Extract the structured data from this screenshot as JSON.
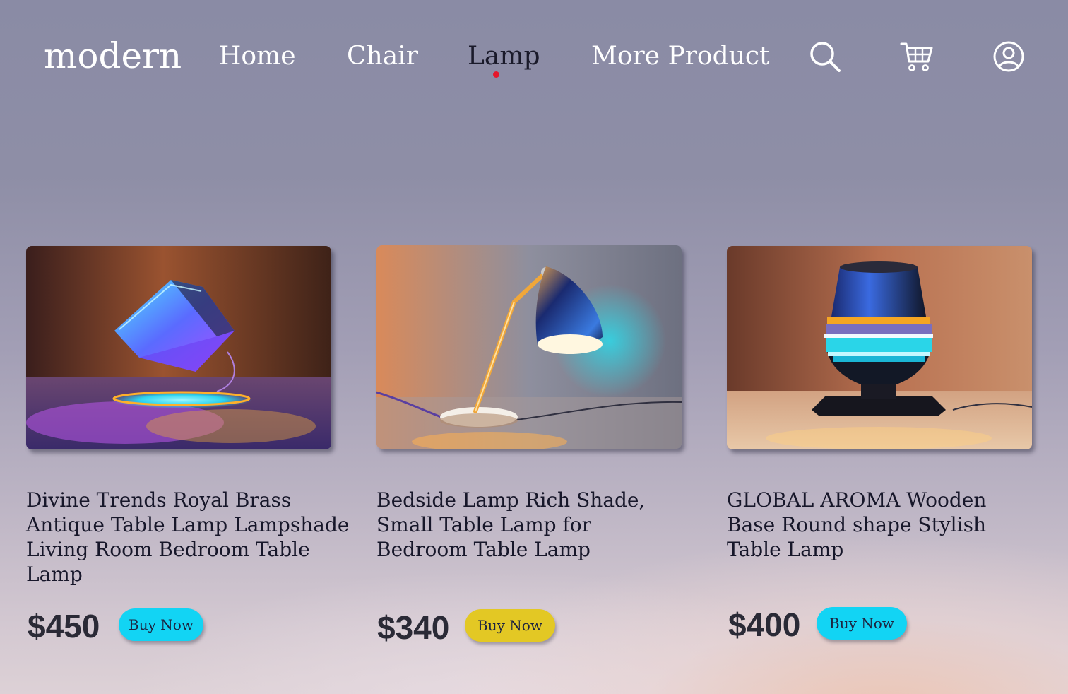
{
  "nav": {
    "logo": "modern",
    "links": [
      {
        "label": "Home",
        "active": false
      },
      {
        "label": "Chair",
        "active": false
      },
      {
        "label": "Lamp",
        "active": true
      },
      {
        "label": "More Product",
        "active": false
      }
    ],
    "icons": [
      "search-icon",
      "cart-icon",
      "user-icon"
    ],
    "active_indicator_color": "#e5172b"
  },
  "products": [
    {
      "title": "Divine Trends Royal Brass Antique Table Lamp Lampshade Living Room Bedroom Table Lamp",
      "price": "$450",
      "button": "Buy Now",
      "button_color": "#12d4f4"
    },
    {
      "title": "Bedside Lamp  Rich Shade, Small Table Lamp for Bedroom Table Lamp",
      "price": "$340",
      "button": "Buy Now",
      "button_color": "#e3c824"
    },
    {
      "title": "GLOBAL AROMA Wooden Base Round shape Stylish Table Lamp",
      "price": "$400",
      "button": "Buy Now",
      "button_color": "#12d4f4"
    }
  ]
}
